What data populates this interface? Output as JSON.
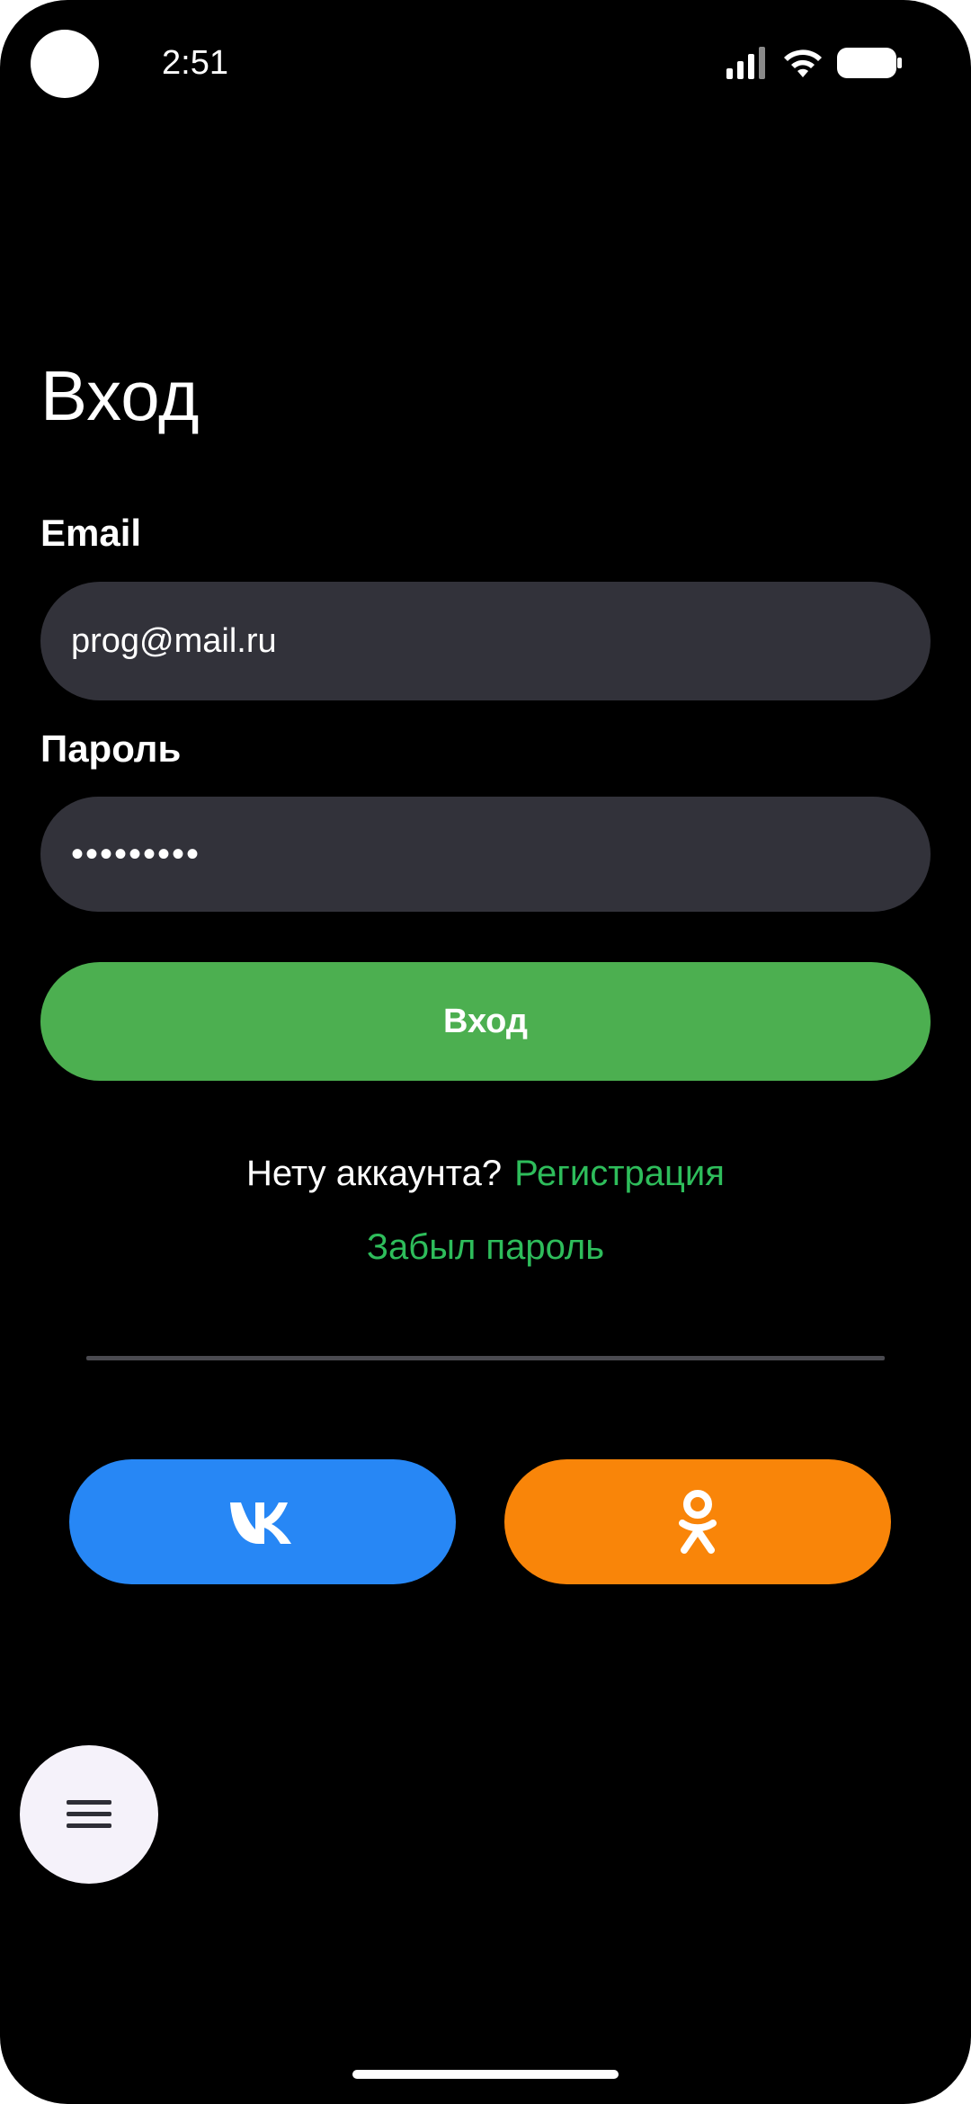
{
  "status_bar": {
    "time": "2:51",
    "icons": [
      "signal-icon",
      "wifi-icon",
      "battery-icon"
    ]
  },
  "login": {
    "title": "Вход",
    "email_label": "Email",
    "email_value": "prog@mail.ru",
    "password_label": "Пароль",
    "password_value": "•••••••••",
    "login_button": "Вход",
    "no_account_text": "Нету аккаунта?",
    "register_link": "Регистрация",
    "forgot_password_link": "Забыл пароль"
  },
  "social": {
    "vk_icon": "vk-icon",
    "ok_icon": "odnoklassniki-icon",
    "vk_color": "#2787f5",
    "ok_color": "#f98509"
  },
  "colors": {
    "background": "#000000",
    "input_bg": "#32323a",
    "accent_green": "#4caf50",
    "link_green": "#2ebd5b"
  },
  "fab": {
    "icon": "menu-icon"
  }
}
